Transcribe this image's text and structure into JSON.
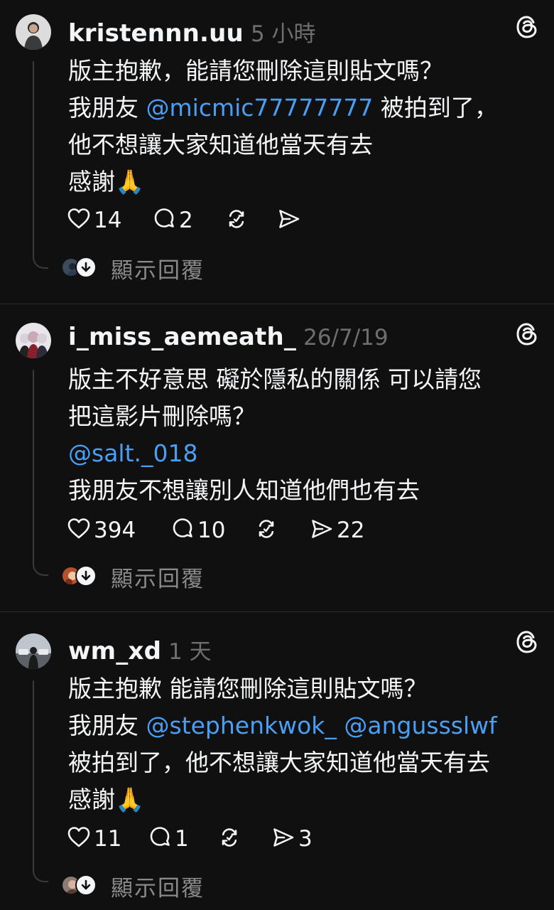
{
  "posts": [
    {
      "username": "kristennn.uu",
      "time": "5 小時",
      "body": [
        [
          {
            "t": "版主抱歉，能請您刪除這則貼文嗎？",
            "m": false
          }
        ],
        [
          {
            "t": "我朋友 ",
            "m": false
          },
          {
            "t": "@micmic77777777",
            "m": true
          },
          {
            "t": " 被拍到了，",
            "m": false
          }
        ],
        [
          {
            "t": "他不想讓大家知道他當天有去",
            "m": false
          }
        ],
        [
          {
            "t": "感謝🙏",
            "m": false
          }
        ]
      ],
      "likes": "14",
      "comments": "2",
      "reposts": "",
      "shares": "",
      "replies_label": "顯示回覆"
    },
    {
      "username": "i_miss_aemeath_",
      "time": "26/7/19",
      "body": [
        [
          {
            "t": "版主不好意思 礙於隱私的關係 可以請您",
            "m": false
          }
        ],
        [
          {
            "t": "把這影片刪除嗎？",
            "m": false
          }
        ],
        [
          {
            "t": "@salt._018",
            "m": true
          }
        ],
        [
          {
            "t": " 我朋友不想讓別人知道他們也有去",
            "m": false
          }
        ]
      ],
      "likes": "394",
      "comments": "10",
      "reposts": "",
      "shares": "22",
      "replies_label": "顯示回覆"
    },
    {
      "username": "wm_xd",
      "time": "1 天",
      "body": [
        [
          {
            "t": "版主抱歉 能請您刪除這則貼文嗎？",
            "m": false
          }
        ],
        [
          {
            "t": "我朋友 ",
            "m": false
          },
          {
            "t": "@stephenkwok_",
            "m": true
          },
          {
            "t": " ",
            "m": false
          },
          {
            "t": "@angussslwf",
            "m": true
          }
        ],
        [
          {
            "t": "被拍到了，他不想讓大家知道他當天有去",
            "m": false
          }
        ],
        [
          {
            "t": "感謝🙏",
            "m": false
          }
        ]
      ],
      "likes": "11",
      "comments": "1",
      "reposts": "",
      "shares": "3",
      "replies_label": "顯示回覆"
    }
  ],
  "icons": {
    "like": "heart-icon",
    "comment": "comment-icon",
    "repost": "repost-icon",
    "share": "share-icon",
    "threads": "threads-logo-icon",
    "show_replies": "arrow-down-icon"
  },
  "colors": {
    "background": "#101010",
    "text": "#f3f5f7",
    "secondary": "#6e6e6e",
    "mention": "#4a9ff5",
    "divider": "#2b2b2b"
  }
}
